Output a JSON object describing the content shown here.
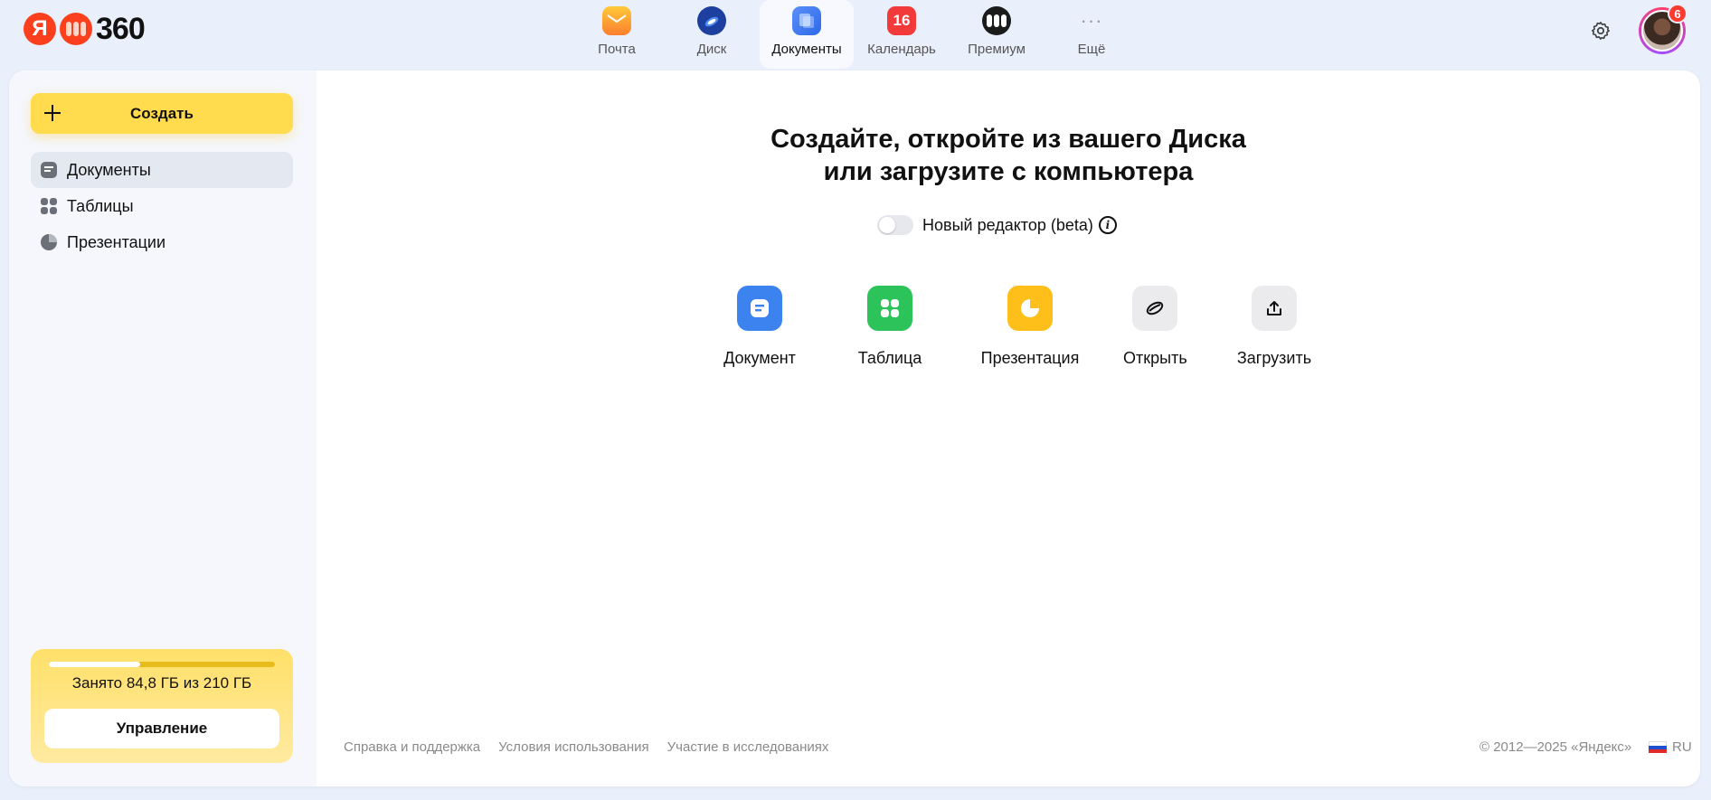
{
  "logo": {
    "ya": "Я",
    "num": "360"
  },
  "apps": [
    {
      "label": "Почта"
    },
    {
      "label": "Диск"
    },
    {
      "label": "Документы"
    },
    {
      "label": "Календарь",
      "badge": "16"
    },
    {
      "label": "Премиум"
    },
    {
      "label": "Ещё",
      "glyph": "···"
    }
  ],
  "header": {
    "notifications": "6"
  },
  "sidebar": {
    "create_label": "Создать",
    "items": [
      {
        "label": "Документы"
      },
      {
        "label": "Таблицы"
      },
      {
        "label": "Презентации"
      }
    ],
    "storage": {
      "used_text": "Занято 84,8 ГБ из 210 ГБ",
      "used_fraction": 0.404,
      "manage_label": "Управление"
    }
  },
  "main": {
    "heading_line1": "Создайте, откройте из вашего Диска",
    "heading_line2": "или загрузите с компьютера",
    "toggle_label": "Новый редактор (beta)",
    "info_glyph": "i",
    "actions": [
      {
        "label": "Документ"
      },
      {
        "label": "Таблица"
      },
      {
        "label": "Презентация"
      },
      {
        "label": "Открыть"
      },
      {
        "label": "Загрузить"
      }
    ]
  },
  "footer": {
    "links": [
      "Справка и поддержка",
      "Условия использования",
      "Участие в исследованиях"
    ],
    "copyright": "© 2012—2025 «Яндекс»",
    "lang": "RU"
  },
  "colors": {
    "background": "#eaf0fb",
    "create_button": "#ffdb4d",
    "doc_icon": "#3d83f0",
    "table_icon": "#2cc35a",
    "presentation_icon": "#ffbf1a"
  }
}
